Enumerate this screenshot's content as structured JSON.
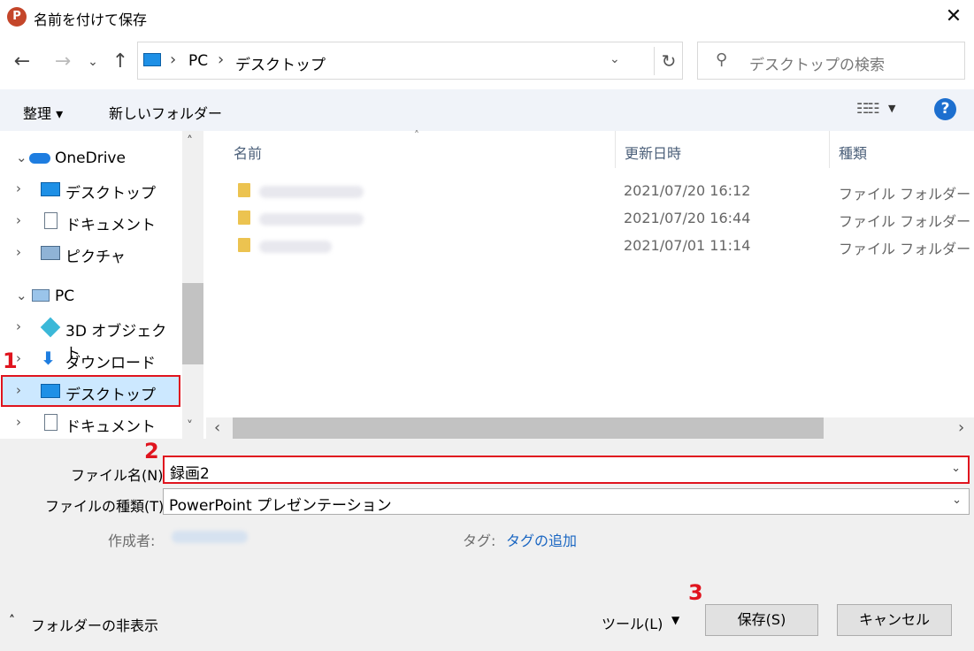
{
  "window": {
    "title": "名前を付けて保存",
    "app_icon": "P",
    "close": "✕"
  },
  "nav_buttons": {
    "back": "←",
    "forward": "→",
    "recent": "⌄",
    "up": "↑"
  },
  "address": {
    "root": "PC",
    "current": "デスクトップ",
    "sep": "›",
    "dropdown": "⌄",
    "refresh": "↻"
  },
  "search": {
    "placeholder": "デスクトップの検索",
    "icon": "⚲"
  },
  "toolbar": {
    "organize": "整理 ▾",
    "new_folder": "新しいフォルダー",
    "view_icon": "☷☷",
    "view_dd": "▼",
    "help": "?"
  },
  "sidebar": {
    "onedrive": {
      "label": "OneDrive",
      "chev": "⌄"
    },
    "onedrive_items": [
      {
        "label": "デスクトップ",
        "chev": "›"
      },
      {
        "label": "ドキュメント",
        "chev": "›"
      },
      {
        "label": "ピクチャ",
        "chev": "›"
      }
    ],
    "pc": {
      "label": "PC",
      "chev": "⌄"
    },
    "pc_items": [
      {
        "label": "3D オブジェクト",
        "chev": "›"
      },
      {
        "label": "ダウンロード",
        "chev": "›"
      },
      {
        "label": "デスクトップ",
        "chev": "›"
      },
      {
        "label": "ドキュメント",
        "chev": "›"
      }
    ],
    "scroll_up": "˄",
    "scroll_down": "˅"
  },
  "columns": {
    "name": "名前",
    "modified": "更新日時",
    "type": "種類",
    "sort_arrow": "˄"
  },
  "files": [
    {
      "modified": "2021/07/20 16:12",
      "type": "ファイル フォルダー"
    },
    {
      "modified": "2021/07/20 16:44",
      "type": "ファイル フォルダー"
    },
    {
      "modified": "2021/07/01 11:14",
      "type": "ファイル フォルダー"
    }
  ],
  "hscroll": {
    "left": "‹",
    "right": "›"
  },
  "form": {
    "filename_label": "ファイル名(N):",
    "filename_value": "録画2",
    "filetype_label": "ファイルの種類(T):",
    "filetype_value": "PowerPoint プレゼンテーション",
    "author_label": "作成者:",
    "tags_label": "タグ:",
    "tags_link": "タグの追加",
    "dd": "⌄"
  },
  "footer": {
    "hide_folders": "フォルダーの非表示",
    "hide_chev": "˄",
    "tools": "ツール(L)",
    "tools_dd": "▼",
    "save": "保存(S)",
    "cancel": "キャンセル"
  },
  "annotations": {
    "n1": "1",
    "n2": "2",
    "n3": "3"
  }
}
